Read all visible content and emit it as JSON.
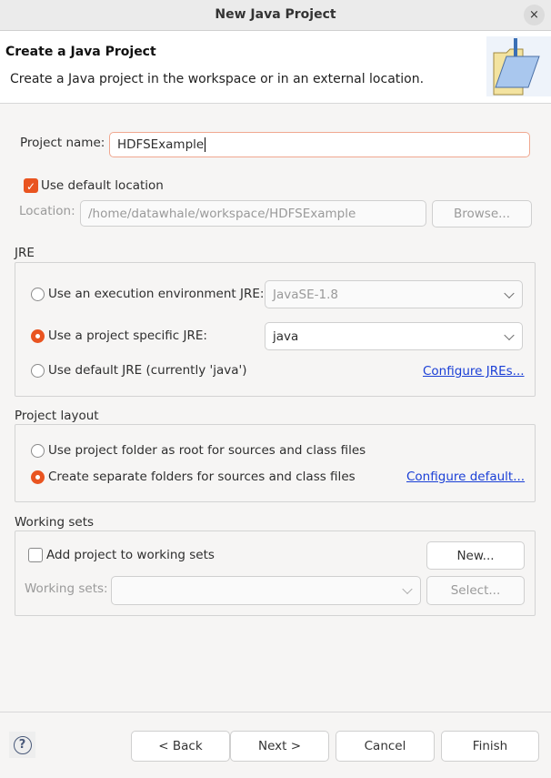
{
  "window": {
    "title": "New Java Project",
    "close": "×"
  },
  "header": {
    "title": "Create a Java Project",
    "description": "Create a Java project in the workspace or in an external location."
  },
  "project_name": {
    "label": "Project name:",
    "value": "HDFSExample"
  },
  "default_location": {
    "label": "Use default location",
    "checked": true
  },
  "location": {
    "label": "Location:",
    "value": "/home/datawhale/workspace/HDFSExample",
    "browse": "Browse..."
  },
  "jre": {
    "title": "JRE",
    "options": [
      {
        "label": "Use an execution environment JRE:",
        "selected": false,
        "combo": "JavaSE-1.8"
      },
      {
        "label": "Use a project specific JRE:",
        "selected": true,
        "combo": "java"
      },
      {
        "label": "Use default JRE (currently 'java')",
        "selected": false
      }
    ],
    "configure_link": "Configure JREs..."
  },
  "layout": {
    "title": "Project layout",
    "options": [
      {
        "label": "Use project folder as root for sources and class files",
        "selected": false
      },
      {
        "label": "Create separate folders for sources and class files",
        "selected": true
      }
    ],
    "configure_link": "Configure default..."
  },
  "working_sets": {
    "title": "Working sets",
    "add_label": "Add project to working sets",
    "checked": false,
    "new_button": "New...",
    "sets_label": "Working sets:",
    "sets_value": "",
    "select_button": "Select..."
  },
  "footer": {
    "help": "?",
    "back": "< Back",
    "next": "Next >",
    "cancel": "Cancel",
    "finish": "Finish"
  },
  "colors": {
    "accent": "#e95420",
    "link": "#1a3fd6"
  }
}
